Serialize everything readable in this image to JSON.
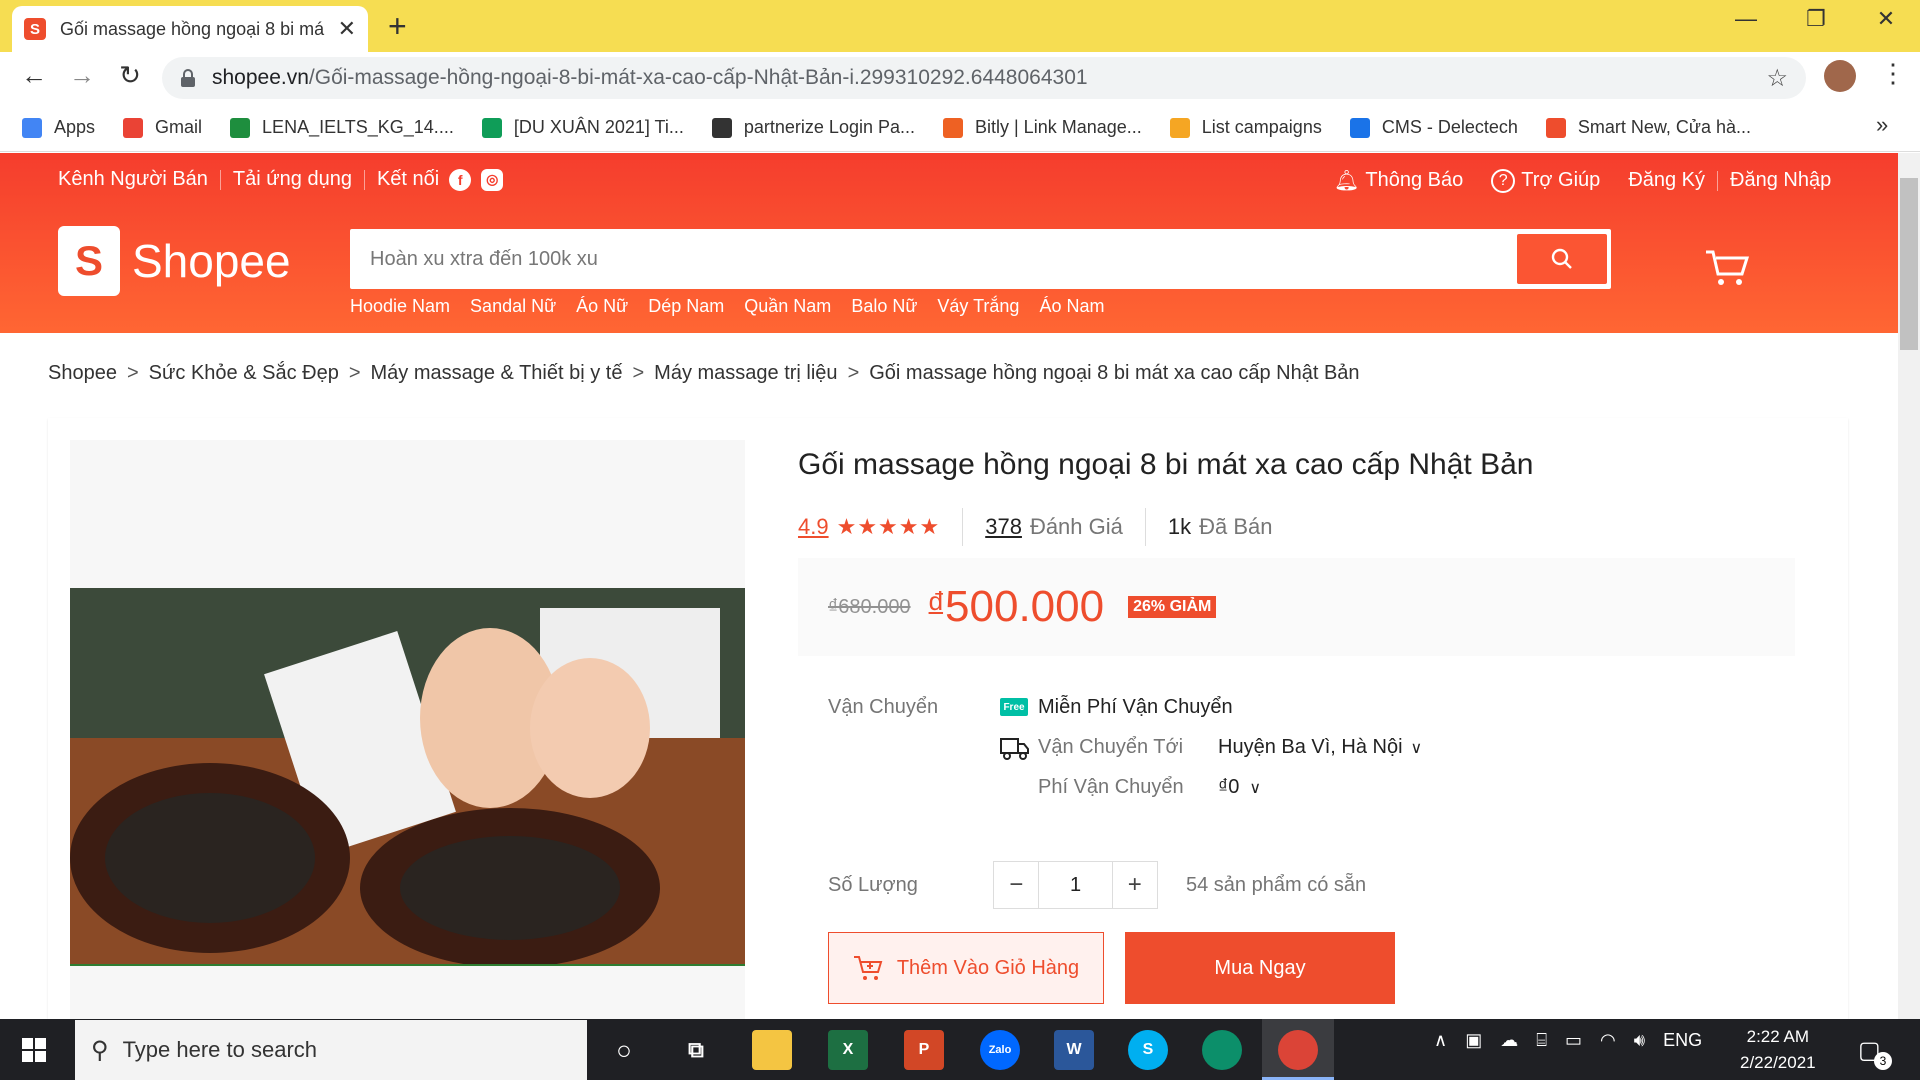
{
  "browser": {
    "tab_title": "Gối massage hồng ngoại 8 bi má",
    "url_host": "shopee.vn",
    "url_path": "/Gối-massage-hồng-ngoại-8-bi-mát-xa-cao-cấp-Nhật-Bản-i.299310292.6448064301",
    "bookmarks": [
      {
        "label": "Apps",
        "icon": "apps-grid-icon",
        "color": "#4285f4"
      },
      {
        "label": "Gmail",
        "icon": "gmail-icon",
        "color": "#ea4335"
      },
      {
        "label": "LENA_IELTS_KG_14....",
        "icon": "classroom-icon",
        "color": "#1e8e3e"
      },
      {
        "label": "[DU XUÂN 2021] Ti...",
        "icon": "sheets-icon",
        "color": "#0f9d58"
      },
      {
        "label": "partnerize Login Pa...",
        "icon": "partnerize-icon",
        "color": "#333333"
      },
      {
        "label": "Bitly | Link Manage...",
        "icon": "bitly-icon",
        "color": "#ee6123"
      },
      {
        "label": "List campaigns",
        "icon": "accesstrade-icon",
        "color": "#f5a623"
      },
      {
        "label": "CMS - Delectech",
        "icon": "cms-icon",
        "color": "#1a73e8"
      },
      {
        "label": "Smart New, Cửa hà...",
        "icon": "shopee-bag-icon",
        "color": "#ee4d2d"
      }
    ]
  },
  "shopee": {
    "top_left": [
      "Kênh Người Bán",
      "Tải ứng dụng",
      "Kết nối"
    ],
    "top_right": {
      "notify": "Thông Báo",
      "help": "Trợ Giúp",
      "register": "Đăng Ký",
      "login": "Đăng Nhập"
    },
    "logo_text": "Shopee",
    "search_placeholder": "Hoàn xu xtra đến 100k xu",
    "hotwords": [
      "Hoodie Nam",
      "Sandal Nữ",
      "Áo Nữ",
      "Dép Nam",
      "Quần Nam",
      "Balo Nữ",
      "Váy Trắng",
      "Áo Nam"
    ],
    "brand_color": "#ee4d2d"
  },
  "breadcrumb": [
    "Shopee",
    "Sức Khỏe & Sắc Đẹp",
    "Máy massage & Thiết bị y tế",
    "Máy massage trị liệu",
    "Gối massage hồng ngoại 8 bi mát xa cao cấp Nhật Bản"
  ],
  "product": {
    "title": "Gối massage hồng ngoại 8 bi mát xa cao cấp Nhật Bản",
    "rating": "4.9",
    "stars": "★★★★★",
    "reviews_count": "378",
    "reviews_label": "Đánh Giá",
    "sold_count": "1k",
    "sold_label": "Đã Bán",
    "old_price": "₫680.000",
    "currency": "đ",
    "price": "500.000",
    "discount": "26% GIẢM",
    "shipping_label": "Vận Chuyển",
    "free_badge": "Free",
    "free_shipping": "Miễn Phí Vận Chuyển",
    "ship_to_label": "Vận Chuyển Tới",
    "ship_to_value": "Huyện Ba Vì, Hà Nội",
    "ship_fee_label": "Phí Vận Chuyển",
    "ship_fee_value": "₫0",
    "qty_label": "Số Lượng",
    "qty_value": "1",
    "stock": "54 sản phẩm có sẵn",
    "add_to_cart": "Thêm Vào Giỏ Hàng",
    "buy_now": "Mua Ngay"
  },
  "taskbar": {
    "search_placeholder": "Type here to search",
    "lang": "ENG",
    "time": "2:22 AM",
    "date": "2/22/2021",
    "notif_count": "3"
  }
}
